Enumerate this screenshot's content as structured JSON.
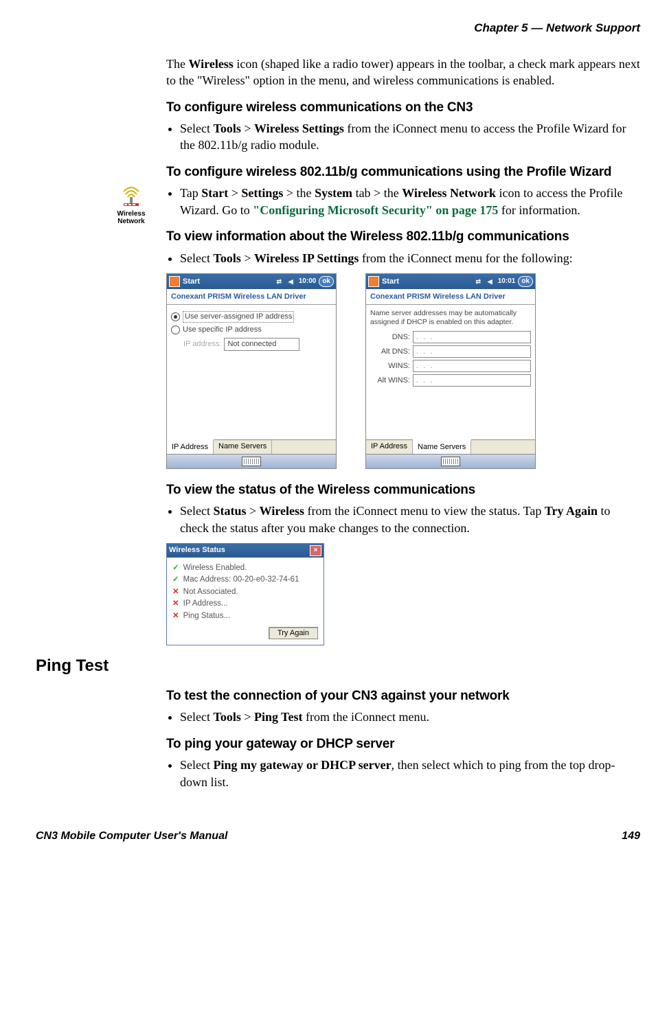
{
  "header": {
    "chapter_line": "Chapter 5 —  Network Support"
  },
  "intro": {
    "text_prefix": "The ",
    "bold1": "Wireless",
    "text_suffix": " icon (shaped like a radio tower) appears in the toolbar, a check mark appears next to the \"Wireless\" option in the menu, and wireless communications is enabled."
  },
  "h1": "To configure wireless communications on the CN3",
  "li1": {
    "pre": "Select ",
    "b1": "Tools",
    "mid1": " > ",
    "b2": "Wireless Settings",
    "post": " from the iConnect menu to access the Profile Wizard for the 802.11b/g radio module."
  },
  "h2": "To configure wireless 802.11b/g communications using the Profile Wizard",
  "li2": {
    "pre": "Tap ",
    "b1": "Start",
    "mid1": " > ",
    "b2": "Settings",
    "mid2": " > the ",
    "b3": "System",
    "mid3": " tab > the ",
    "b4": "Wireless Network",
    "mid4": " icon to access the Profile Wizard. Go to ",
    "xref": "\"Configuring Microsoft Security\" on page 175",
    "post": " for information."
  },
  "side_icon": {
    "line1": "Wireless",
    "line2": "Network"
  },
  "h3": "To view information about the Wireless 802.11b/g communications",
  "li3": {
    "pre": "Select ",
    "b1": "Tools",
    "mid1": " > ",
    "b2": "Wireless IP Settings",
    "post": " from the iConnect menu for the following:"
  },
  "pda_common": {
    "start": "Start",
    "driver_title": "Conexant PRISM Wireless LAN Driver",
    "tab_ip": "IP Address",
    "tab_ns": "Name Servers",
    "ok": "ok"
  },
  "pda1": {
    "time": "10:00",
    "radio_server": "Use server-assigned IP address",
    "radio_specific": "Use specific IP address",
    "ip_label": "IP address:",
    "ip_value": "Not connected"
  },
  "pda2": {
    "time": "10:01",
    "note": "Name server addresses may be automatically assigned if DHCP is enabled on this adapter.",
    "dns": "DNS:",
    "altdns": "Alt DNS:",
    "wins": "WINS:",
    "altwins": "Alt WINS:",
    "dots": ".   .   ."
  },
  "h4": "To view the status of the Wireless communications",
  "li4": {
    "pre": "Select ",
    "b1": "Status",
    "mid1": " > ",
    "b2": "Wireless",
    "mid2": " from the iConnect menu to view the status. Tap ",
    "b3": "Try Again",
    "post": " to check the status after you make changes to the connection."
  },
  "status": {
    "title": "Wireless Status",
    "l1": "Wireless Enabled.",
    "l2": "Mac Address: 00-20-e0-32-74-61",
    "l3": "Not Associated.",
    "l4": "IP Address...",
    "l5": "Ping Status...",
    "btn": "Try Again"
  },
  "section_heading": "Ping Test",
  "h5": "To test the connection of your CN3 against your network",
  "li5": {
    "pre": "Select ",
    "b1": "Tools",
    "mid1": " > ",
    "b2": "Ping Test",
    "post": " from the iConnect menu."
  },
  "h6": "To ping your gateway or DHCP server",
  "li6": {
    "pre": "Select ",
    "b1": "Ping my gateway or DHCP server",
    "post": ", then select which to ping from the top drop-down list."
  },
  "footer": {
    "left": "CN3 Mobile Computer User's Manual",
    "right": "149"
  }
}
